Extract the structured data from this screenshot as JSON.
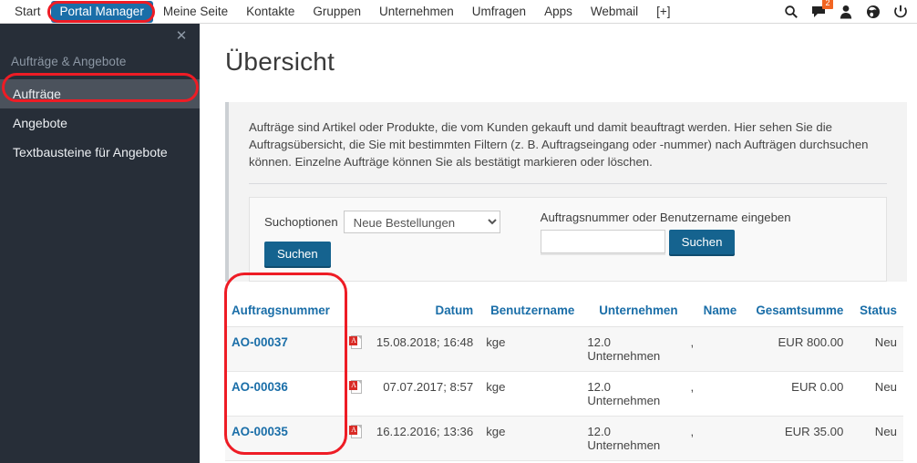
{
  "topnav": {
    "items": [
      {
        "label": "Start",
        "active": false
      },
      {
        "label": "Portal Manager",
        "active": true
      },
      {
        "label": "Meine Seite",
        "active": false
      },
      {
        "label": "Kontakte",
        "active": false
      },
      {
        "label": "Gruppen",
        "active": false
      },
      {
        "label": "Unternehmen",
        "active": false
      },
      {
        "label": "Umfragen",
        "active": false
      },
      {
        "label": "Apps",
        "active": false
      },
      {
        "label": "Webmail",
        "active": false
      },
      {
        "label": "[+]",
        "active": false
      }
    ],
    "icons": [
      {
        "name": "search-icon"
      },
      {
        "name": "messages-icon",
        "badge": "2"
      },
      {
        "name": "user-icon"
      },
      {
        "name": "globe-icon"
      },
      {
        "name": "power-icon"
      }
    ],
    "accent_color": "#1a6ea8",
    "badge_color": "#f26522"
  },
  "sidebar": {
    "close_label": "✕",
    "title": "Aufträge & Angebote",
    "items": [
      {
        "label": "Aufträge",
        "selected": true
      },
      {
        "label": "Angebote",
        "selected": false
      },
      {
        "label": "Textbausteine für Angebote",
        "selected": false
      }
    ],
    "background_color": "#272e38",
    "selected_color": "#4b525c"
  },
  "main": {
    "page_title": "Übersicht",
    "description": "Aufträge sind Artikel oder Produkte, die vom Kunden gekauft und damit beauftragt werden. Hier sehen Sie die Auftragsübersicht, die Sie mit bestimmten Filtern (z. B. Auftragseingang oder -nummer) nach Aufträgen durchsuchen können. Einzelne Aufträge können Sie als bestätigt markieren oder löschen.",
    "search": {
      "options_label": "Suchoptionen",
      "selected_option": "Neue Bestellungen",
      "options": [
        "Neue Bestellungen"
      ],
      "options_submit_label": "Suchen",
      "query_hint": "Auftragsnummer oder Benutzername eingeben",
      "query_value": "",
      "query_placeholder": "",
      "query_submit_label": "Suchen"
    },
    "table": {
      "columns": [
        "Auftragsnummer",
        "",
        "Datum",
        "Benutzername",
        "Unternehmen",
        "Name",
        "Gesamtsumme",
        "Status"
      ],
      "rows": [
        {
          "order_no": "AO-00037",
          "pdf": "pdf-icon",
          "date": "15.08.2018; 16:48",
          "user": "kge",
          "company": "12.0 Unternehmen",
          "name": ",",
          "total": "EUR 800.00",
          "status": "Neu"
        },
        {
          "order_no": "AO-00036",
          "pdf": "pdf-icon",
          "date": "07.07.2017; 8:57",
          "user": "kge",
          "company": "12.0 Unternehmen",
          "name": ",",
          "total": "EUR 0.00",
          "status": "Neu"
        },
        {
          "order_no": "AO-00035",
          "pdf": "pdf-icon",
          "date": "16.12.2016; 13:36",
          "user": "kge",
          "company": "12.0 Unternehmen",
          "name": ",",
          "total": "EUR 35.00",
          "status": "Neu"
        }
      ]
    }
  },
  "annotations": {
    "color": "#ee1c25",
    "targets": [
      "portal-manager-nav-item",
      "sidebar-item-auftraege",
      "table-column-auftragsnummer"
    ]
  }
}
